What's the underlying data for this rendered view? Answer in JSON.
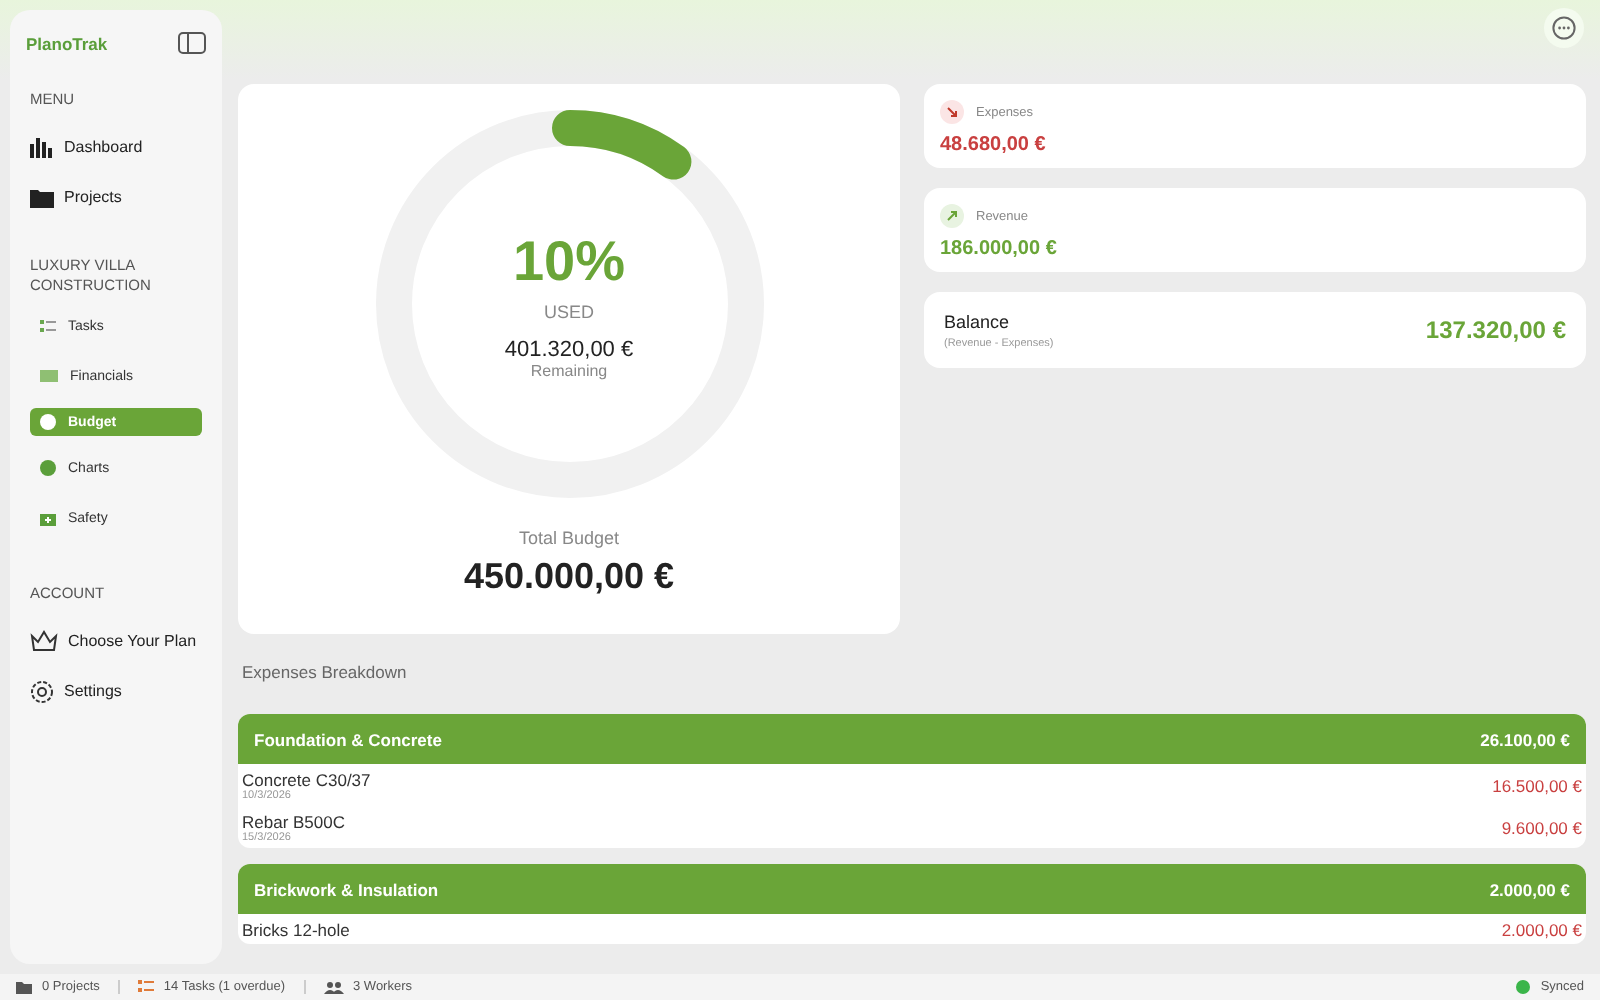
{
  "sidebar": {
    "brand": "PlanoTrak",
    "sections": [
      {
        "title": "MENU",
        "kind": "main",
        "items": [
          {
            "label": "Dashboard",
            "selected": false
          },
          {
            "label": "Projects",
            "selected": false
          }
        ]
      },
      {
        "title": "LUXURY VILLA CONSTRUCTION",
        "kind": "project",
        "items": [
          {
            "label": "Tasks",
            "selected": false
          },
          {
            "label": "Financials",
            "selected": false
          },
          {
            "label": "Budget",
            "selected": true
          },
          {
            "label": "Charts",
            "selected": false
          },
          {
            "label": "Safety",
            "selected": false
          }
        ]
      },
      {
        "title": "ACCOUNT",
        "kind": "main",
        "items": [
          {
            "label": "Choose Your Plan",
            "selected": false
          },
          {
            "label": "Settings",
            "selected": false
          }
        ]
      }
    ]
  },
  "budget": {
    "percent": "10%",
    "used_label": "USED",
    "remaining": "401.320,00 €",
    "remaining_label": "Remaining",
    "total_label": "Total Budget",
    "total": "450.000,00 €"
  },
  "stats": [
    {
      "kind": "expense",
      "label": "Expenses",
      "value": "48.680,00 €"
    },
    {
      "kind": "revenue",
      "label": "Revenue",
      "value": "186.000,00 €"
    }
  ],
  "balance": {
    "title": "Balance",
    "subtitle": "(Revenue - Expenses)",
    "value": "137.320,00 €"
  },
  "breakdown": {
    "title": "Expenses Breakdown",
    "groups": [
      {
        "name": "Foundation & Concrete",
        "total": "26.100,00 €",
        "items": [
          {
            "name": "Concrete C30/37",
            "date": "10/3/2026",
            "amount": "16.500,00 €"
          },
          {
            "name": "Rebar B500C",
            "date": "15/3/2026",
            "amount": "9.600,00 €"
          }
        ]
      },
      {
        "name": "Brickwork & Insulation",
        "total": "2.000,00 €",
        "items": [
          {
            "name": "Bricks 12-hole",
            "amount": "2.000,00 €"
          }
        ]
      }
    ]
  },
  "status_bar": {
    "projects": "0 Projects",
    "tasks": "14 Tasks (1 overdue)",
    "workers": "3 Workers",
    "sync": "Synced"
  }
}
